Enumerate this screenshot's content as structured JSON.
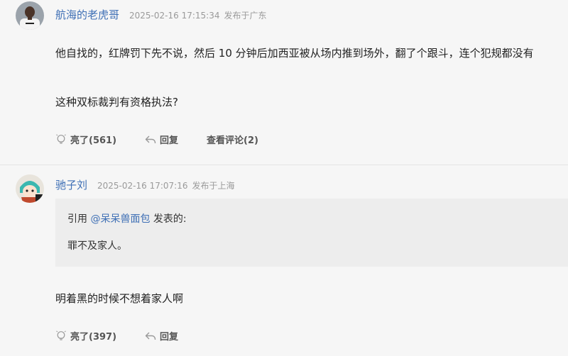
{
  "posts": [
    {
      "username": "航海的老虎哥",
      "timestamp": "2025-02-16 17:15:34",
      "location": "发布于广东",
      "paragraphs": [
        "他自找的，红牌罚下先不说，然后 10 分钟后加西亚被从场内推到场外，翻了个跟斗，连个犯规都没有",
        "这种双标裁判有资格执法?"
      ],
      "actions": {
        "like": "亮了(561)",
        "reply": "回复",
        "view_comments": "查看评论(2)"
      }
    },
    {
      "username": "驰子刘",
      "timestamp": "2025-02-16 17:07:16",
      "location": "发布于上海",
      "quote": {
        "prefix": "引用 ",
        "user": "@呆呆兽面包",
        "suffix": " 发表的:",
        "text": "罪不及家人。"
      },
      "paragraphs": [
        "明着黑的时候不想着家人啊"
      ],
      "actions": {
        "like": "亮了(397)",
        "reply": "回复"
      }
    }
  ],
  "icons": {
    "like": "thumbs-up-lightbulb-icon",
    "reply": "reply-arrow-icon"
  },
  "colors": {
    "username": "#3e6fb5",
    "meta": "#9a9a9a",
    "quote_bg": "#ededed",
    "divider": "#e4e4e4"
  }
}
